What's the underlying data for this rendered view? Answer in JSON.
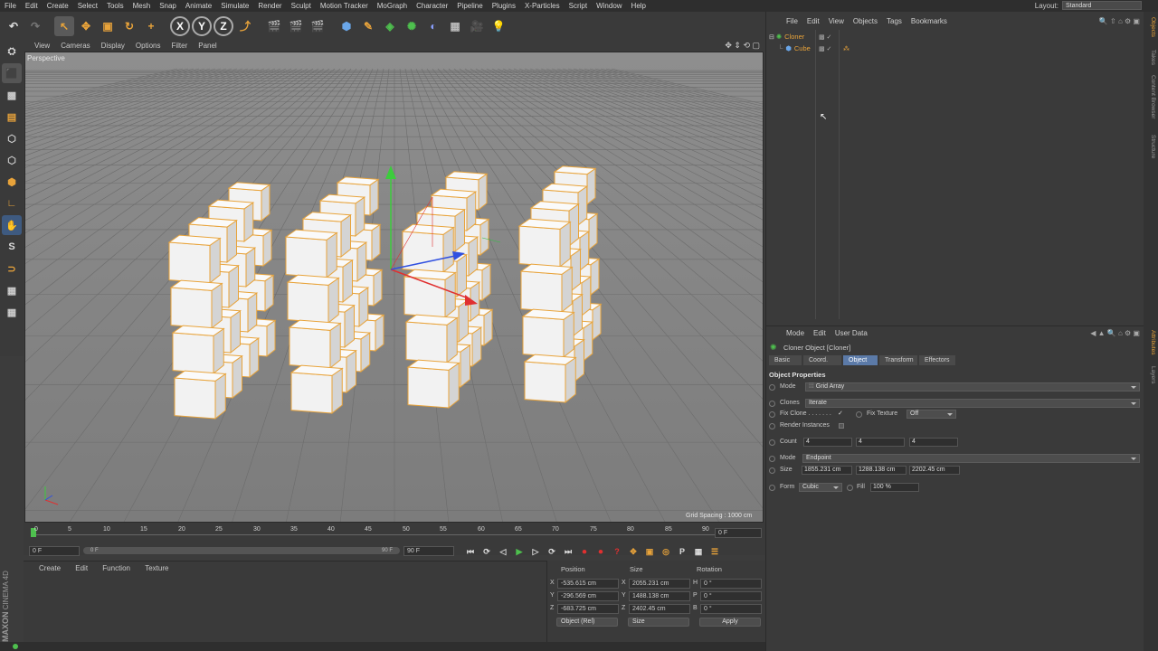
{
  "menubar": {
    "items": [
      "File",
      "Edit",
      "Create",
      "Select",
      "Tools",
      "Mesh",
      "Snap",
      "Animate",
      "Simulate",
      "Render",
      "Sculpt",
      "Motion Tracker",
      "MoGraph",
      "Character",
      "Pipeline",
      "Plugins",
      "X-Particles",
      "Script",
      "Window",
      "Help"
    ],
    "layout_label": "Layout:",
    "layout_value": "Standard"
  },
  "viewport": {
    "menu": [
      "View",
      "Cameras",
      "Display",
      "Options",
      "Filter",
      "Panel"
    ],
    "label": "Perspective",
    "grid_spacing": "Grid Spacing : 1000 cm"
  },
  "timeline": {
    "ticks": [
      "0",
      "5",
      "10",
      "15",
      "20",
      "25",
      "30",
      "35",
      "40",
      "45",
      "50",
      "55",
      "60",
      "65",
      "70",
      "75",
      "80",
      "85",
      "90"
    ],
    "current_frame": "0 F",
    "start_field": "0 F",
    "slider_start": "0 F",
    "slider_end": "90 F",
    "end_field": "90 F"
  },
  "material_manager": {
    "menu": [
      "Create",
      "Edit",
      "Function",
      "Texture"
    ]
  },
  "coord_manager": {
    "headers": {
      "position": "Position",
      "size": "Size",
      "rotation": "Rotation"
    },
    "rows": [
      {
        "axis": "X",
        "pos": "-535.615 cm",
        "size_axis": "X",
        "size": "2055.231 cm",
        "rot_axis": "H",
        "rot": "0 °"
      },
      {
        "axis": "Y",
        "pos": "-296.569 cm",
        "size_axis": "Y",
        "size": "1488.138 cm",
        "rot_axis": "P",
        "rot": "0 °"
      },
      {
        "axis": "Z",
        "pos": "-683.725 cm",
        "size_axis": "Z",
        "size": "2402.45 cm",
        "rot_axis": "B",
        "rot": "0 °"
      }
    ],
    "mode_dropdown": "Object (Rel)",
    "size_dropdown": "Size",
    "apply_label": "Apply"
  },
  "brand": {
    "line1": "MAXON",
    "line2": "CINEMA 4D"
  },
  "object_manager": {
    "menu": [
      "File",
      "Edit",
      "View",
      "Objects",
      "Tags",
      "Bookmarks"
    ],
    "objects": [
      {
        "name": "Cloner",
        "color": "#e8a33a"
      },
      {
        "name": "Cube",
        "color": "#e8a33a"
      }
    ]
  },
  "attributes": {
    "menu": [
      "Mode",
      "Edit",
      "User Data"
    ],
    "title": "Cloner Object [Cloner]",
    "tabs": [
      "Basic",
      "Coord.",
      "Object",
      "Transform",
      "Effectors"
    ],
    "active_tab": "Object",
    "section": "Object Properties",
    "mode_label": "Mode",
    "mode_value": "Grid Array",
    "clones_label": "Clones",
    "clones_value": "Iterate",
    "fix_clone_label": "Fix Clone . . . . . . .",
    "fix_clone_check": "✓",
    "fix_texture_label": "Fix Texture",
    "fix_texture_value": "Off",
    "render_instances_label": "Render Instances",
    "count_label": "Count",
    "count_values": [
      "4",
      "4",
      "4"
    ],
    "mode2_label": "Mode",
    "mode2_value": "Endpoint",
    "size_label": "Size",
    "size_values": [
      "1855.231 cm",
      "1288.138 cm",
      "2202.45 cm"
    ],
    "form_label": "Form",
    "form_value": "Cubic",
    "fill_label": "Fill",
    "fill_value": "100 %"
  },
  "right_strip_tabs": [
    "Objects",
    "Takes",
    "Content Browser",
    "Structure",
    "Attributes",
    "Layers"
  ],
  "colors": {
    "accent": "#5b7aa8",
    "orange": "#e8a33a",
    "axis_x": "#e03030",
    "axis_y": "#30c040",
    "axis_z": "#3050e0"
  }
}
